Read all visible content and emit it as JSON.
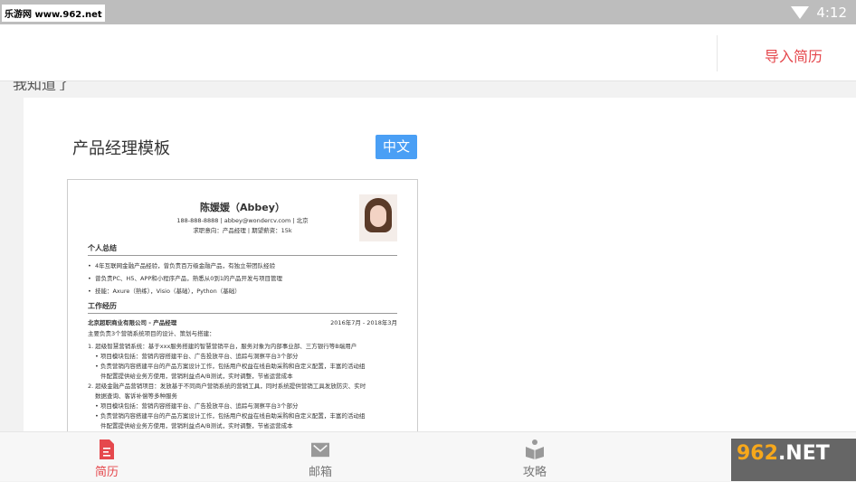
{
  "status_bar": {
    "watermark": "乐游网 www.962.net",
    "time": "4:12"
  },
  "header": {
    "import_label": "导入简历"
  },
  "hint": "我知道了",
  "template": {
    "title": "产品经理模板",
    "language_badge": "中文",
    "resume": {
      "name": "陈媛媛（Abbey）",
      "contact": "188-888-8888 | abbey@wondercv.com | 北京",
      "intent": "求职意向：产品经理 | 期望薪资：15k",
      "summary_title": "个人总结",
      "summary": [
        "4年互联网金融产品经验，曾负责百万级金融产品，有独立带团队经验",
        "曾负责PC、H5、APP和小程序产品，熟悉从0到1的产品开发与项目管理",
        "技能：Axure（熟练），Visio（基础），Python（基础）"
      ],
      "work_title": "工作经历",
      "company": "北京超职商业有限公司 - 产品经理",
      "period": "2016年7月 - 2018年3月",
      "work_intro": "主要负责3个营销系统项目的设计、策划与搭建：",
      "work_lines": [
        "1. 超级智慧营销系统：基于xxx服务搭建的智慧营销平台，服务对象为内部事业部、三方银行等B端用户",
        "• 项目模块包括：营销内容搭建平台、广告投放平台、追踪与洞察平台3个部分",
        "• 负责营销内容搭建平台的产品方案设计工作，包括用户权益在线自助采购和自定义配置，丰富的活动组",
        "件配置提供给业务方使用，营销利益点A/B测试，实时调整，节省运营成本",
        "2. 超级金融产品营销项目：发放基于不同商户营销系统的营销工具，同时系统提供营销工具发放防灾、实时",
        "数据查询、客诉补偿等多种服务",
        "• 项目模块包括：营销内容搭建平台、广告投放平台、追踪与洞察平台3个部分",
        "• 负责营销内容搭建平台的产品方案设计工作，包括用户权益在线自助采购和自定义配置，丰富的活动组",
        "件配置提供给业务方使用，营销利益点A/B测试，实时调整，节省运营成本"
      ]
    }
  },
  "bottom_nav": [
    {
      "label": "简历",
      "active": true
    },
    {
      "label": "邮箱"
    },
    {
      "label": "攻略"
    }
  ],
  "logo": {
    "text": "962.NET 乐游网"
  },
  "colors": {
    "accent": "#e5484d",
    "badge": "#4a9ff5"
  }
}
